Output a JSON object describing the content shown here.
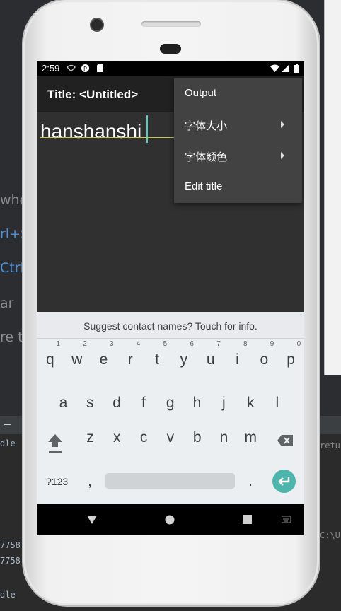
{
  "ide": {
    "line1": "whe",
    "line2": "rl+S",
    "line3": "Ctrl",
    "line4": "ar",
    "line5": "re to",
    "console1": "dle",
    "console2": "7758",
    "console3": "7758",
    "console4": "dle",
    "console_right1": "retur",
    "console_right2": "C:\\U",
    "console_dash": "—"
  },
  "status_bar": {
    "time": "2:59"
  },
  "app_bar": {
    "title": "Title: <Untitled>"
  },
  "editor": {
    "text": "hanshanshi"
  },
  "overflow_menu": {
    "items": [
      {
        "label": "Output",
        "submenu": false
      },
      {
        "label": "字体大小",
        "submenu": true
      },
      {
        "label": "字体颜色",
        "submenu": true
      },
      {
        "label": "Edit title",
        "submenu": false
      }
    ]
  },
  "keyboard": {
    "suggestion": "Suggest contact names? Touch for info.",
    "row1": [
      {
        "k": "q",
        "h": "1"
      },
      {
        "k": "w",
        "h": "2"
      },
      {
        "k": "e",
        "h": "3"
      },
      {
        "k": "r",
        "h": "4"
      },
      {
        "k": "t",
        "h": "5"
      },
      {
        "k": "y",
        "h": "6"
      },
      {
        "k": "u",
        "h": "7"
      },
      {
        "k": "i",
        "h": "8"
      },
      {
        "k": "o",
        "h": "9"
      },
      {
        "k": "p",
        "h": "0"
      }
    ],
    "row2": [
      "a",
      "s",
      "d",
      "f",
      "g",
      "h",
      "j",
      "k",
      "l"
    ],
    "row3": [
      "z",
      "x",
      "c",
      "v",
      "b",
      "n",
      "m"
    ],
    "symbols_label": "?123",
    "comma": ",",
    "period": "."
  },
  "nav_icons": [
    "back-icon",
    "home-icon",
    "recents-icon",
    "keyboard-switch-icon"
  ]
}
